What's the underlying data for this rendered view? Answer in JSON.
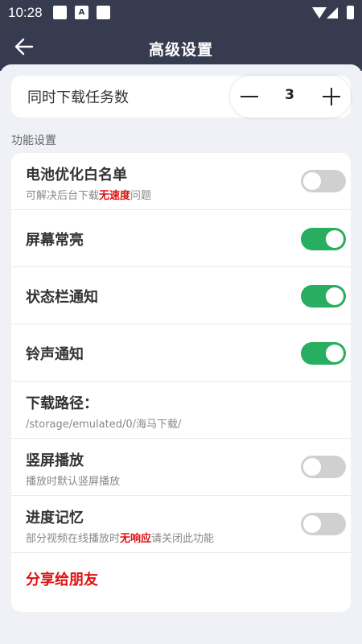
{
  "statusbar": {
    "time": "10:28",
    "icon_a": "A"
  },
  "header": {
    "title": "高级设置"
  },
  "download_tasks": {
    "label": "同时下载任务数",
    "value": "3"
  },
  "section_title": "功能设置",
  "settings": [
    {
      "title": "电池优化白名单",
      "sub_pre": "可解决后台下载",
      "sub_hl": "无速度",
      "sub_post": "问题",
      "toggle": false
    },
    {
      "title": "屏幕常亮",
      "toggle": true
    },
    {
      "title": "状态栏通知",
      "toggle": true
    },
    {
      "title": "铃声通知",
      "toggle": true
    },
    {
      "title": "下载路径：",
      "sub": "/storage/emulated/0/海马下载/"
    },
    {
      "title": "竖屏播放",
      "sub": "播放时默认竖屏播放",
      "toggle": false
    },
    {
      "title": "进度记忆",
      "sub_pre": "部分视频在线播放时",
      "sub_hl": "无响应",
      "sub_post": "请关闭此功能",
      "toggle": false
    }
  ],
  "share": {
    "label": "分享给朋友"
  },
  "colors": {
    "header_bg": "#373b50",
    "toggle_on": "#27ae60",
    "toggle_off": "#d0d0d0",
    "highlight": "#e01010"
  },
  "icons": {
    "back": "arrow-left-icon",
    "minus": "minus-icon",
    "plus": "plus-icon"
  }
}
